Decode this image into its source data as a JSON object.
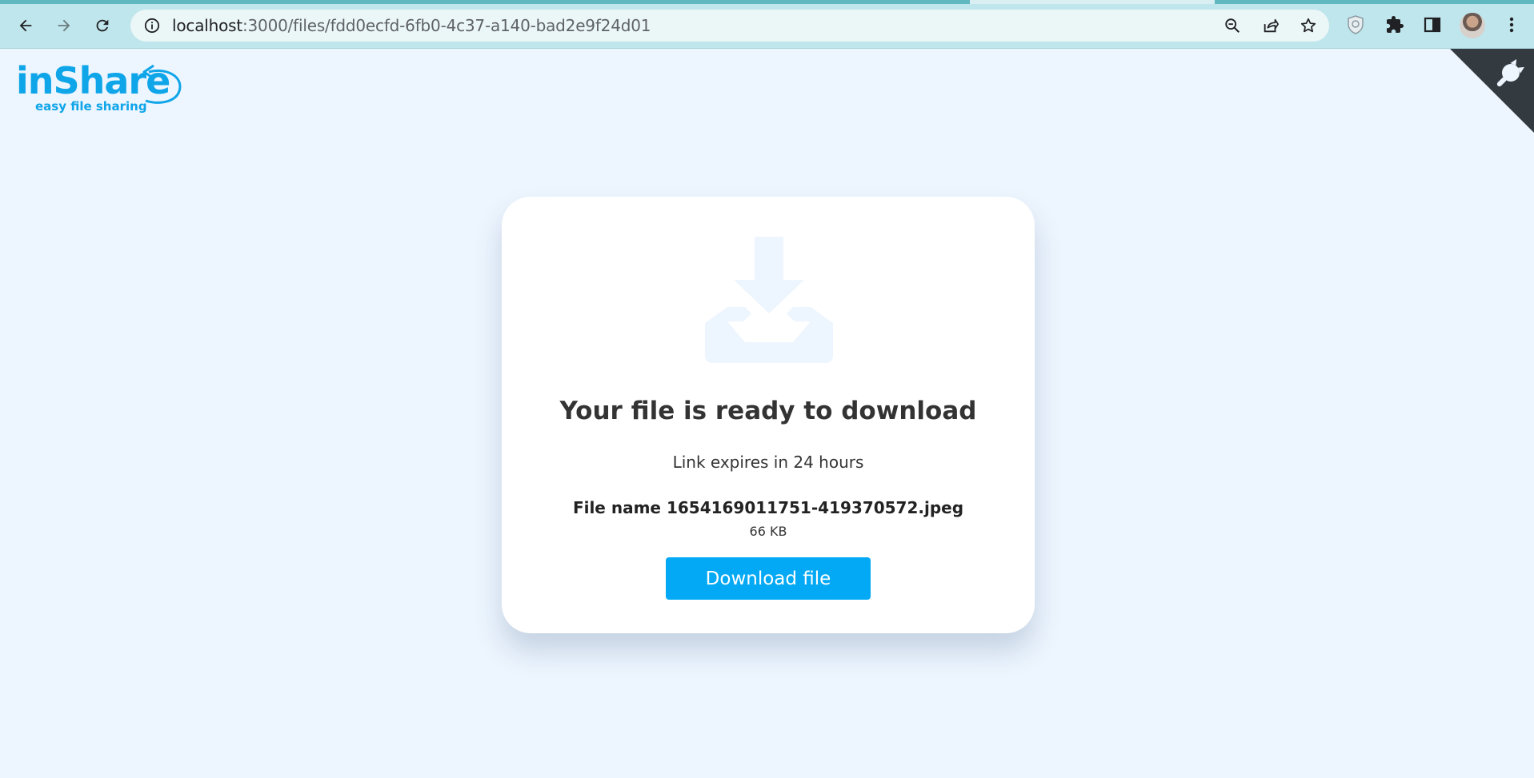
{
  "browser": {
    "url_host": "localhost",
    "url_path": ":3000/files/fdd0ecfd-6fb0-4c37-a140-bad2e9f24d01",
    "icons": [
      "back-icon",
      "forward-icon",
      "reload-icon",
      "info-icon",
      "zoom-out-icon",
      "share-icon",
      "star-icon",
      "shield-extension-icon",
      "puzzle-icon",
      "side-panel-icon",
      "profile-avatar",
      "kebab-menu-icon"
    ]
  },
  "logo": {
    "title": "inShare",
    "subtitle": "easy file sharing"
  },
  "download": {
    "title": "Your file is ready to download",
    "expiry": "Link expires in 24 hours",
    "file_name": "File name 1654169011751-419370572.jpeg",
    "file_size": "66 KB",
    "button_label": "Download file"
  },
  "colors": {
    "accent": "#03a9f4",
    "logo": "#0ea5e9",
    "page_bg": "#edf5fe",
    "toolbar_bg": "#bfe6ec"
  }
}
